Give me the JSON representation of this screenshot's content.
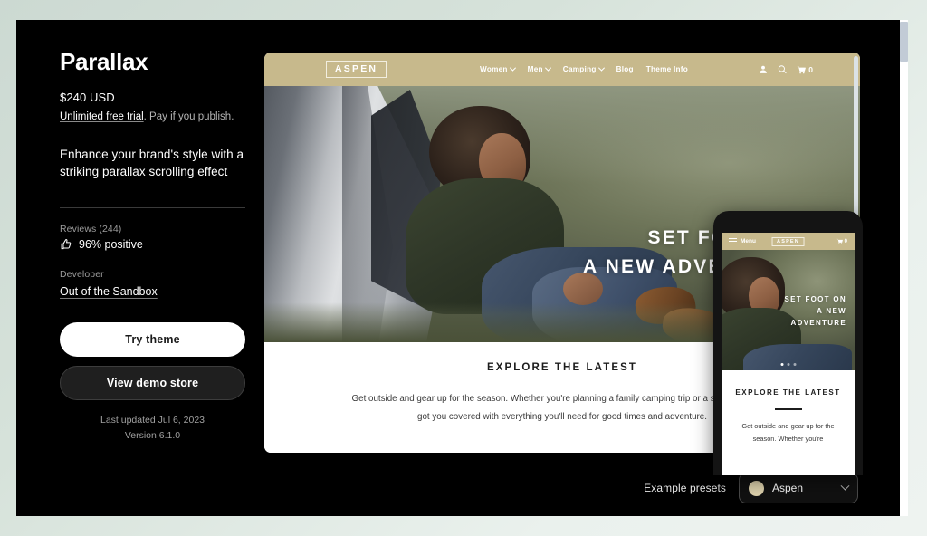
{
  "theme": {
    "title": "Parallax",
    "price": "$240 USD",
    "trial_link": "Unlimited free trial",
    "trial_rest": ". Pay if you publish.",
    "tagline": "Enhance your brand's style with a striking parallax scrolling effect",
    "reviews_label": "Reviews (244)",
    "reviews_positive": "96% positive",
    "developer_label": "Developer",
    "developer_name": "Out of the Sandbox",
    "try_button": "Try theme",
    "demo_button": "View demo store",
    "last_updated": "Last updated Jul 6, 2023",
    "version": "Version 6.1.0"
  },
  "preview": {
    "logo": "ASPEN",
    "nav_links": [
      {
        "label": "Women",
        "has_caret": true
      },
      {
        "label": "Men",
        "has_caret": true
      },
      {
        "label": "Camping",
        "has_caret": true
      },
      {
        "label": "Blog",
        "has_caret": false
      },
      {
        "label": "Theme Info",
        "has_caret": false
      }
    ],
    "cart_count": "0",
    "hero_title": "SET FOOT ON\nA NEW ADVENTURE",
    "explore_title": "EXPLORE THE LATEST",
    "explore_body": "Get outside and gear up for the season. Whether you're planning a family camping trip or a solo hike, we've got you covered with everything you'll need for good times and adventure."
  },
  "phone": {
    "menu_label": "Menu",
    "logo": "ASPEN",
    "cart_count": "0",
    "hero_title": "SET FOOT ON\nA NEW\nADVENTURE",
    "explore_title": "EXPLORE THE\nLATEST",
    "explore_body": "Get outside and gear up for the season. Whether you're"
  },
  "bottom": {
    "presets_label": "Example presets",
    "selected_preset": "Aspen",
    "swatch_color": "#ded2ad"
  }
}
